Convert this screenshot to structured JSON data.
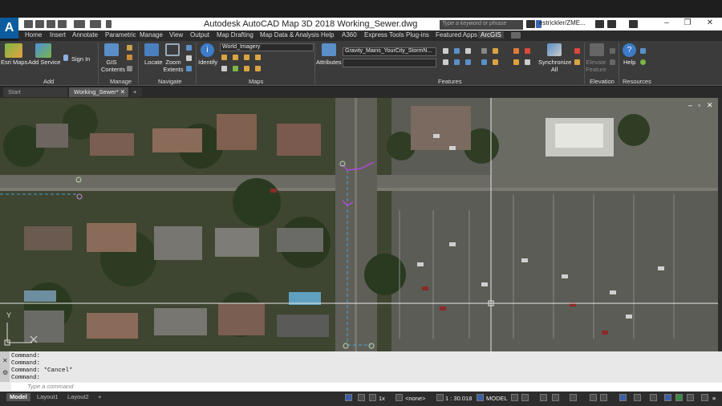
{
  "app": {
    "logo_letter": "A",
    "title": "Autodesk AutoCAD Map 3D 2018   Working_Sewer.dwg",
    "search_placeholder": "Type a keyword or phrase",
    "user": "estrickler/ZME...",
    "window_controls": [
      "–",
      "❐",
      "✕"
    ]
  },
  "menu": {
    "tabs": [
      "Home",
      "Insert",
      "Annotate",
      "Parametric",
      "Manage",
      "View",
      "Output",
      "Map Drafting",
      "Map Data & Analysis",
      "Help",
      "A360",
      "Express Tools",
      "Plug-ins",
      "Featured Apps",
      "ArcGIS"
    ],
    "active_tab": "ArcGIS"
  },
  "ribbon": {
    "buttons": {
      "esri_maps": "Esri Maps",
      "add_service": "Add Service",
      "sign_in": "Sign In",
      "gis_contents": "GIS Contents",
      "locate": "Locate",
      "zoom_extents": "Zoom Extents",
      "identify": "Identify",
      "attributes": "Attributes",
      "synchronize_all": "Synchronize All",
      "elevate_feature": "Elevate Feature",
      "help": "Help"
    },
    "basemap_combo": "World_Imagery",
    "layer_combo": "Gravity_Mains_YourCity_StormN...",
    "layer_combo_2": "",
    "groups": [
      "Add",
      "Manage",
      "Navigate",
      "Maps",
      "Features",
      "Elevation",
      "Resources"
    ]
  },
  "doctabs": {
    "start": "Start",
    "active": "Working_Sewer*",
    "close": "✕",
    "new": "+"
  },
  "viewport": {
    "ucs_y": "Y",
    "ucs_x": "X",
    "controls": [
      "–",
      "▫",
      "✕"
    ]
  },
  "command": {
    "history": [
      "Command:",
      "Command:",
      "Command: *Cancel*",
      "Command:"
    ],
    "placeholder": "Type a command"
  },
  "status": {
    "layouts": [
      "Model",
      "Layout1",
      "Layout2"
    ],
    "add_layout": "+",
    "scale_prefix": "1x",
    "workspace": "<none>",
    "scale": "1 : 30.018",
    "space": "MODEL"
  }
}
